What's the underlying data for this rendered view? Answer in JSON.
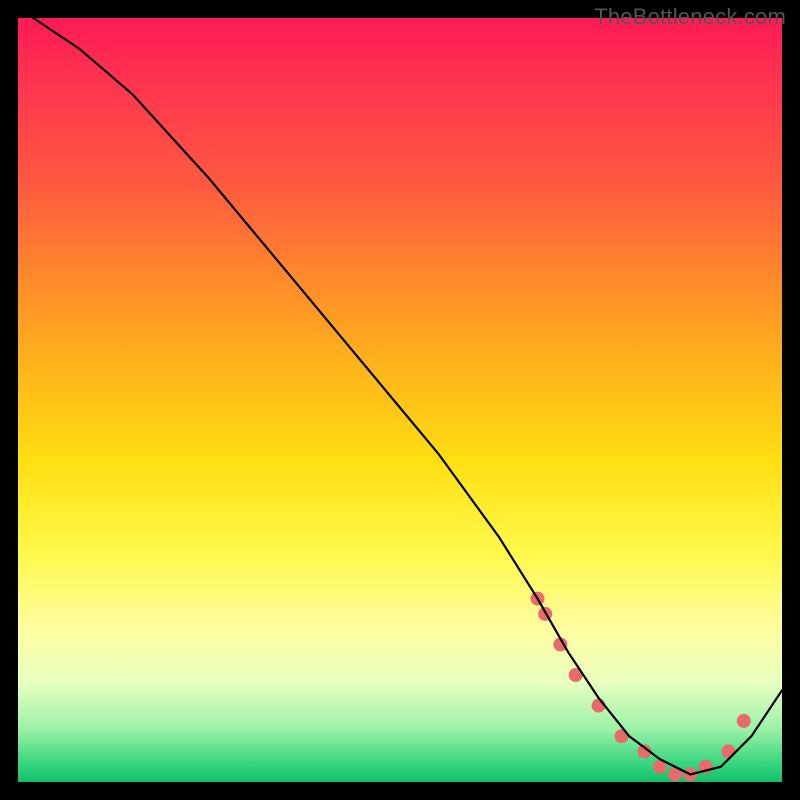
{
  "watermark": "TheBottleneck.com",
  "chart_data": {
    "type": "line",
    "title": "",
    "xlabel": "",
    "ylabel": "",
    "xlim": [
      0,
      100
    ],
    "ylim": [
      0,
      100
    ],
    "grid": false,
    "series": [
      {
        "name": "curve",
        "x": [
          2,
          8,
          15,
          25,
          35,
          45,
          55,
          63,
          68,
          72,
          76,
          80,
          84,
          88,
          92,
          96,
          100
        ],
        "y": [
          100,
          96,
          90,
          79,
          67,
          55,
          43,
          32,
          24,
          17,
          11,
          6,
          3,
          1,
          2,
          6,
          12
        ]
      }
    ],
    "markers": {
      "name": "highlight-dots",
      "x": [
        68,
        69,
        71,
        73,
        76,
        79,
        82,
        84,
        86,
        88,
        90,
        93,
        95
      ],
      "y": [
        24,
        22,
        18,
        14,
        10,
        6,
        4,
        2,
        1,
        1,
        2,
        4,
        8
      ]
    },
    "colors": {
      "curve": "#000000",
      "markers": "#e86a6a",
      "background_top": "#ff1a55",
      "background_bottom": "#12c06a"
    }
  }
}
